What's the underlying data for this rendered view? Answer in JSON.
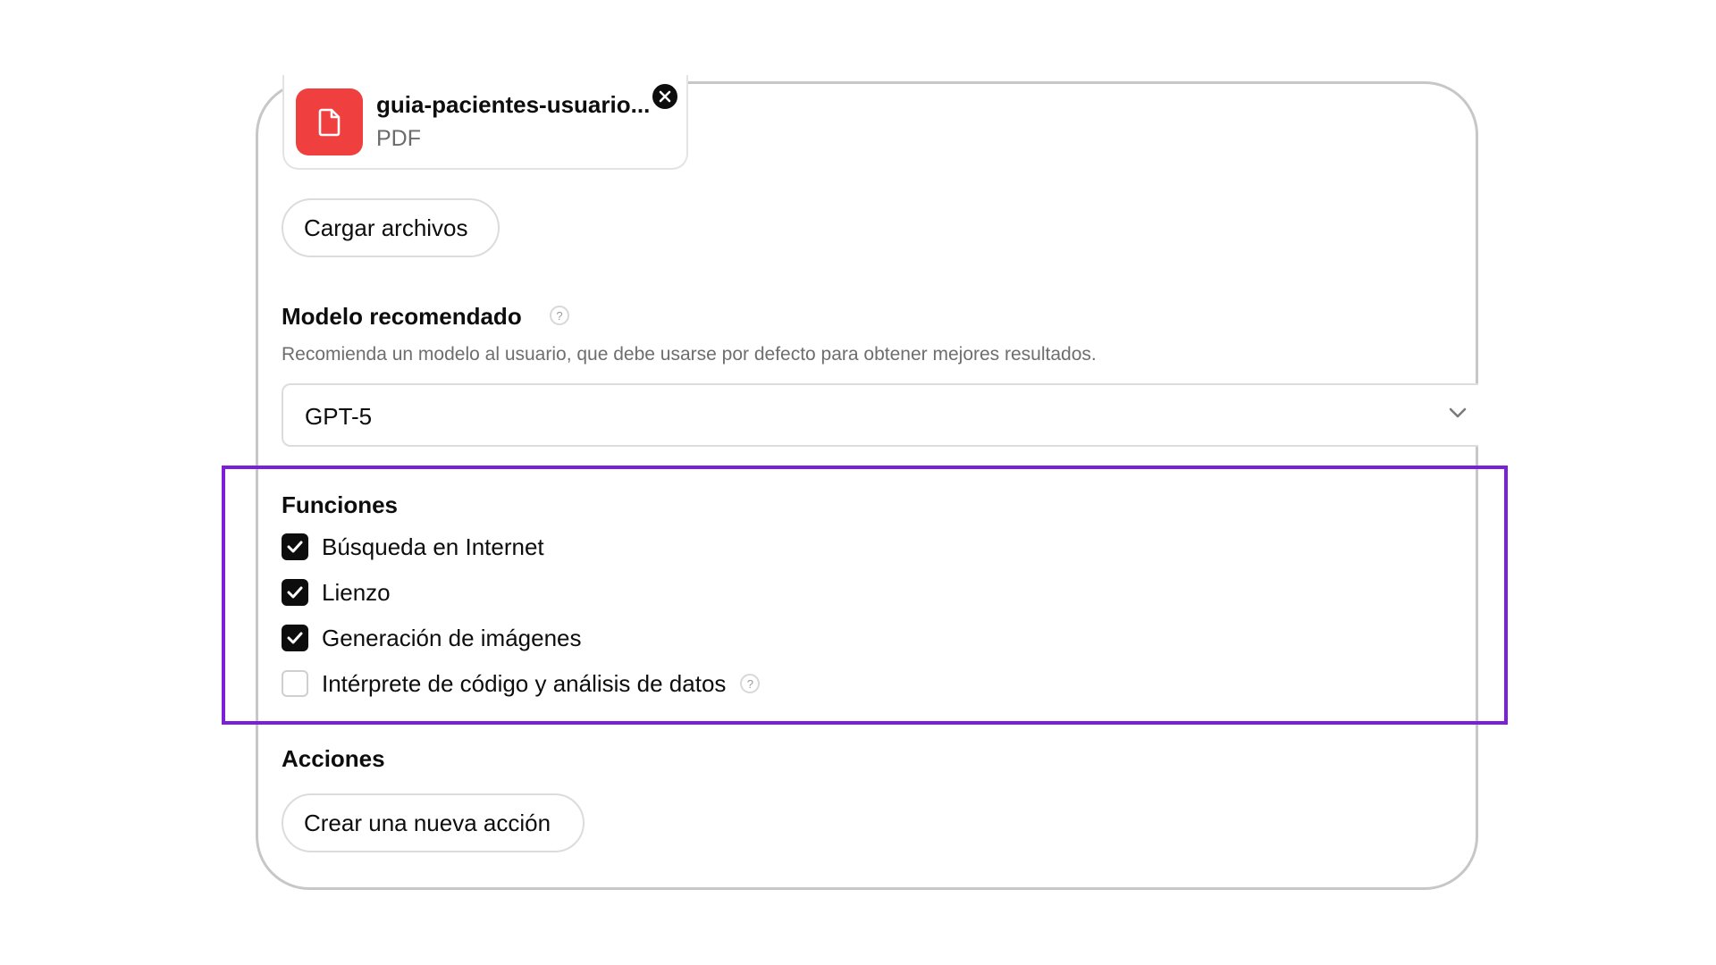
{
  "file": {
    "name": "guia-pacientes-usuario...",
    "type": "PDF"
  },
  "upload_button": "Cargar archivos",
  "model": {
    "title": "Modelo recomendado",
    "help": "?",
    "description": "Recomienda un modelo al usuario, que debe usarse por defecto para obtener mejores resultados.",
    "selected": "GPT-5"
  },
  "functions": {
    "title": "Funciones",
    "items": [
      {
        "label": "Búsqueda en Internet",
        "checked": true
      },
      {
        "label": "Lienzo",
        "checked": true
      },
      {
        "label": "Generación de imágenes",
        "checked": true
      },
      {
        "label": "Intérprete de código y análisis de datos",
        "checked": false,
        "help": "?"
      }
    ]
  },
  "actions": {
    "title": "Acciones",
    "create_button": "Crear una nueva acción"
  },
  "colors": {
    "file_icon_bg": "#f03f3f",
    "highlight": "#7c1fd8"
  }
}
